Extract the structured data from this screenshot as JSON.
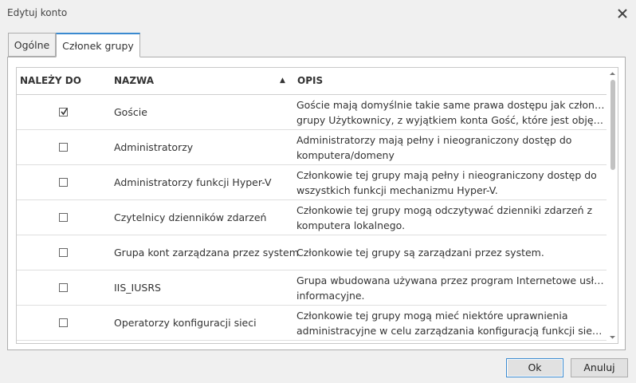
{
  "window": {
    "title": "Edytuj konto"
  },
  "tabs": [
    {
      "label": "Ogólne"
    },
    {
      "label": "Członek grupy"
    }
  ],
  "table": {
    "columns": {
      "member": "NALEŻY DO",
      "name": "NAZWA",
      "desc": "OPIS"
    },
    "sort_icon": "sort-ascending-icon",
    "rows": [
      {
        "checked": true,
        "name": "Goście",
        "desc1": "Goście mają domyślnie takie same prawa dostępu jak członkowie",
        "desc2": "grupy Użytkownicy, z wyjątkiem konta Gość, które jest objęte d..."
      },
      {
        "checked": false,
        "name": "Administratorzy",
        "desc1": "Administratorzy mają pełny i nieograniczony dostęp do",
        "desc2": "komputera/domeny"
      },
      {
        "checked": false,
        "name": "Administratorzy funkcji Hyper-V",
        "desc1": "Członkowie tej grupy mają pełny i nieograniczony dostęp do",
        "desc2": "wszystkich funkcji mechanizmu Hyper-V."
      },
      {
        "checked": false,
        "name": "Czytelnicy dzienników zdarzeń",
        "desc1": "Członkowie tej grupy mogą odczytywać dzienniki zdarzeń z",
        "desc2": "komputera lokalnego."
      },
      {
        "checked": false,
        "name": "Grupa kont zarządzana przez system",
        "desc1": "Członkowie tej grupy są zarządzani przez system.",
        "desc2": ""
      },
      {
        "checked": false,
        "name": "IIS_IUSRS",
        "desc1": "Grupa wbudowana używana przez program Internetowe usługi",
        "desc2": "informacyjne."
      },
      {
        "checked": false,
        "name": "Operatorzy konfiguracji sieci",
        "desc1": "Członkowie tej grupy mogą mieć niektóre uprawnienia",
        "desc2": "administracyjne w celu zarządzania konfiguracją funkcji sieciowy..."
      }
    ]
  },
  "buttons": {
    "ok": "Ok",
    "cancel": "Anuluj"
  },
  "colors": {
    "accent": "#3a8ad0",
    "background": "#f0f0f0"
  }
}
